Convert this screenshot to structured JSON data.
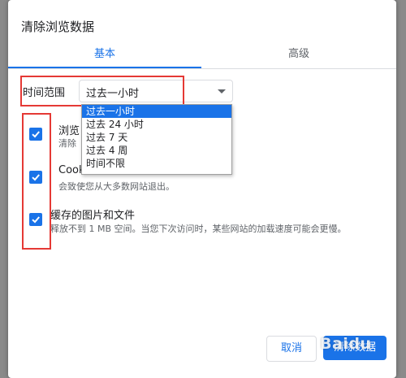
{
  "dialog": {
    "title": "清除浏览数据",
    "tabs": [
      {
        "label": "基本",
        "active": true
      },
      {
        "label": "高级",
        "active": false
      }
    ]
  },
  "time_range": {
    "label": "时间范围",
    "selected": "过去一小时",
    "options": [
      "过去一小时",
      "过去 24 小时",
      "过去 7 天",
      "过去 4 周",
      "时间不限"
    ]
  },
  "items": [
    {
      "title": "浏览",
      "desc": "清除",
      "checked": true
    },
    {
      "title": "Cook",
      "desc": "会致使您从大多数网站退出。",
      "checked": true
    },
    {
      "title": "缓存的图片和文件",
      "desc": "释放不到 1 MB 空间。当您下次访问时，某些网站的加载速度可能会更慢。",
      "checked": true
    }
  ],
  "buttons": {
    "cancel": "取消",
    "clear": "清除数据"
  },
  "watermark": "Baidu",
  "colors": {
    "accent": "#1a73e8",
    "annotation": "#e53935"
  }
}
